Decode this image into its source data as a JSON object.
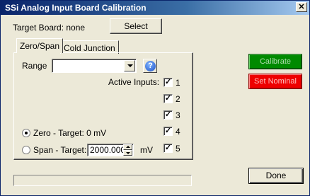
{
  "window": {
    "title": "SSi Analog Input Board Calibration",
    "close_glyph": "✕"
  },
  "target": {
    "label": "Target Board: none",
    "select_label": "Select"
  },
  "tabs": [
    {
      "label": "Zero/Span",
      "active": true
    },
    {
      "label": "Cold Junction",
      "active": false
    }
  ],
  "range": {
    "label": "Range",
    "value": ""
  },
  "help": {
    "glyph": "?"
  },
  "active_inputs": {
    "label": "Active Inputs:",
    "items": [
      {
        "label": "1",
        "checked": true
      },
      {
        "label": "2",
        "checked": true
      },
      {
        "label": "3",
        "checked": true
      },
      {
        "label": "4",
        "checked": true
      },
      {
        "label": "5",
        "checked": true
      }
    ]
  },
  "zero": {
    "label": "Zero - Target: 0 mV",
    "selected": true
  },
  "span": {
    "label": "Span - Target:",
    "value": "2000.000",
    "unit": "mV",
    "selected": false
  },
  "buttons": {
    "calibrate": "Calibrate",
    "set_nominal": "Set Nominal",
    "done": "Done"
  },
  "progress": {
    "fraction": 0
  },
  "colors": {
    "calibrate": "#008a00",
    "set_nominal": "#ee0000",
    "titlebar": "#0a246a",
    "face": "#ece9d8"
  }
}
